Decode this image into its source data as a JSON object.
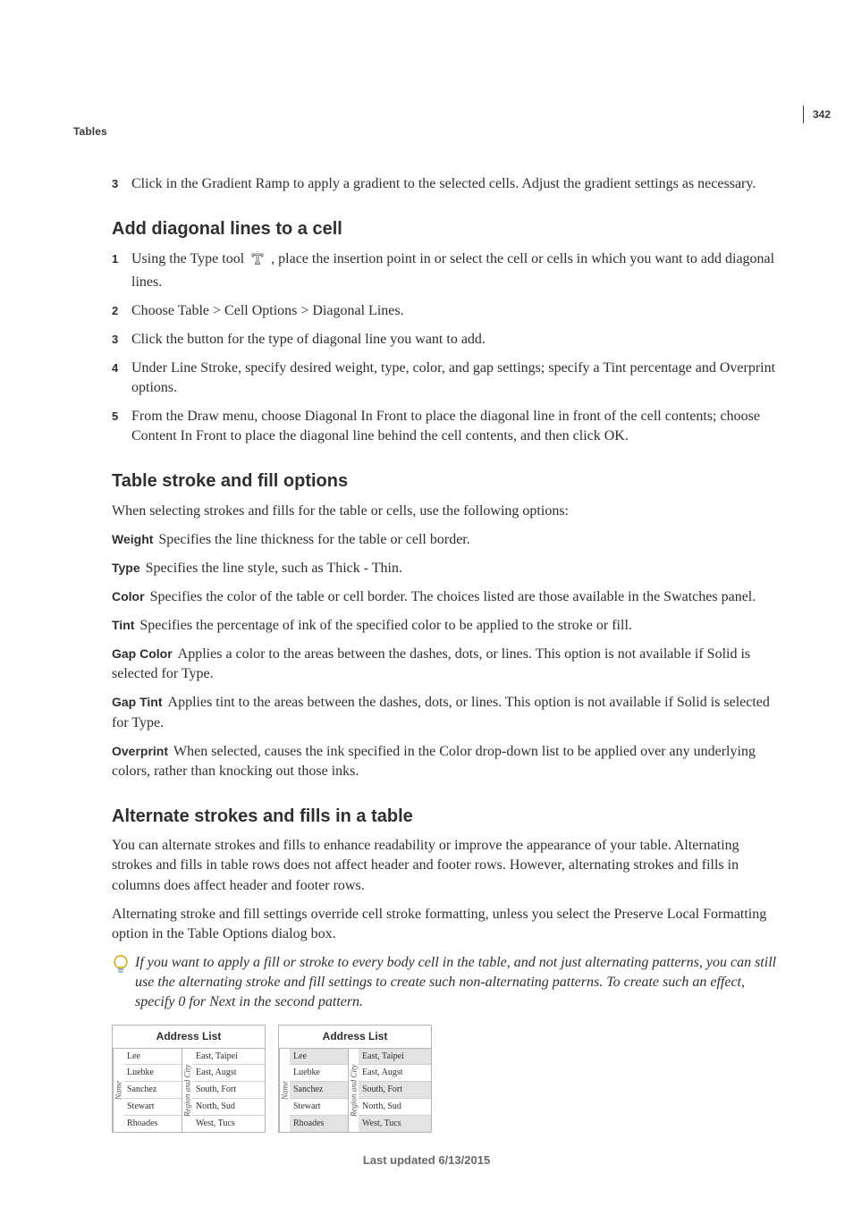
{
  "running_head": "Tables",
  "page_number": "342",
  "footer": "Last updated 6/13/2015",
  "pre_step": {
    "num": "3",
    "text": "Click in the Gradient Ramp to apply a gradient to the selected cells. Adjust the gradient settings as necessary."
  },
  "section_diagonal": {
    "heading": "Add diagonal lines to a cell",
    "steps": [
      {
        "num": "1",
        "pre": "Using the Type tool ",
        "post": " , place the insertion point in or select the cell or cells in which you want to add diagonal lines."
      },
      {
        "num": "2",
        "text": "Choose Table > Cell Options > Diagonal Lines."
      },
      {
        "num": "3",
        "text": "Click the button for the type of diagonal line you want to add."
      },
      {
        "num": "4",
        "text": "Under Line Stroke, specify desired weight, type, color, and gap settings; specify a Tint percentage and Overprint options."
      },
      {
        "num": "5",
        "text": "From the Draw menu, choose Diagonal In Front to place the diagonal line in front of the cell contents; choose Content In Front to place the diagonal line behind the cell contents, and then click OK."
      }
    ]
  },
  "section_stroke_fill": {
    "heading": "Table stroke and fill options",
    "intro": "When selecting strokes and fills for the table or cells, use the following options:",
    "defs": [
      {
        "term": "Weight",
        "desc": "Specifies the line thickness for the table or cell border."
      },
      {
        "term": "Type",
        "desc": "Specifies the line style, such as Thick - Thin."
      },
      {
        "term": "Color",
        "desc": "Specifies the color of the table or cell border. The choices listed are those available in the Swatches panel."
      },
      {
        "term": "Tint",
        "desc": "Specifies the percentage of ink of the specified color to be applied to the stroke or fill."
      },
      {
        "term": "Gap Color",
        "desc": "Applies a color to the areas between the dashes, dots, or lines. This option is not available if Solid is selected for Type."
      },
      {
        "term": "Gap Tint",
        "desc": "Applies tint to the areas between the dashes, dots, or lines. This option is not available if Solid is selected for Type."
      },
      {
        "term": "Overprint",
        "desc": "When selected, causes the ink specified in the Color drop-down list to be applied over any underlying colors, rather than knocking out those inks."
      }
    ]
  },
  "section_alternate": {
    "heading": "Alternate strokes and fills in a table",
    "p1": "You can alternate strokes and fills to enhance readability or improve the appearance of your table. Alternating strokes and fills in table rows does not affect header and footer rows. However, alternating strokes and fills in columns does affect header and footer rows.",
    "p2": "Alternating stroke and fill settings override cell stroke formatting, unless you select the Preserve Local Formatting option in the Table Options dialog box.",
    "tip": "If you want to apply a fill or stroke to every body cell in the table, and not just alternating patterns, you can still use the alternating stroke and fill settings to create such non-alternating patterns. To create such an effect, specify 0 for Next in the second pattern."
  },
  "sample_tables": {
    "title": "Address List",
    "vheader_left": "Name",
    "vheader_right": "Region and City",
    "rows": [
      {
        "name": "Lee",
        "region": "East, Taipei"
      },
      {
        "name": "Luebke",
        "region": "East, Augst"
      },
      {
        "name": "Sanchez",
        "region": "South, Fort"
      },
      {
        "name": "Stewart",
        "region": "North, Sud"
      },
      {
        "name": "Rhoades",
        "region": "West, Tucs"
      }
    ]
  }
}
